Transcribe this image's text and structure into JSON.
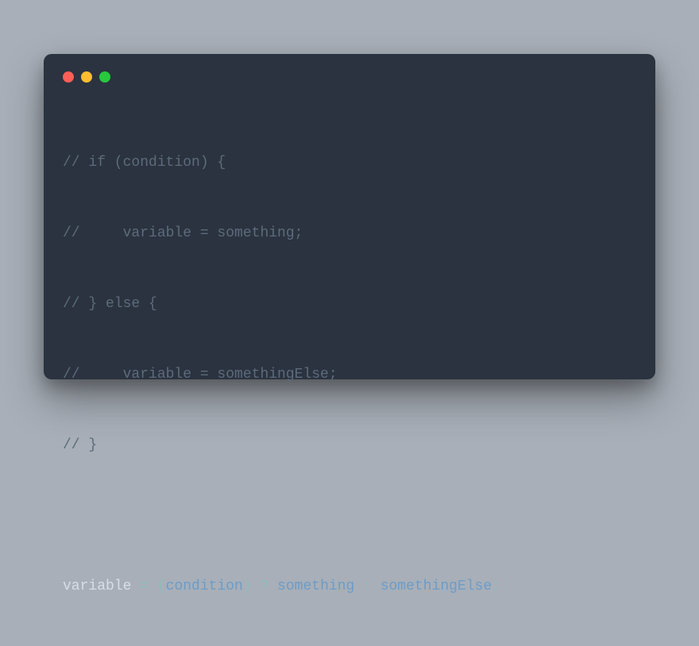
{
  "code": {
    "comments": [
      "// if (condition) {",
      "//     variable = something;",
      "// } else {",
      "//     variable = somethingElse;",
      "// }"
    ],
    "ternary": {
      "variable": "variable",
      "eq": " = ",
      "lp": "(",
      "condition": "condition",
      "rp": ")",
      "q": " ? ",
      "trueVal": "something",
      "colon": " : ",
      "falseVal": "somethingElse",
      "semi": ";"
    }
  }
}
